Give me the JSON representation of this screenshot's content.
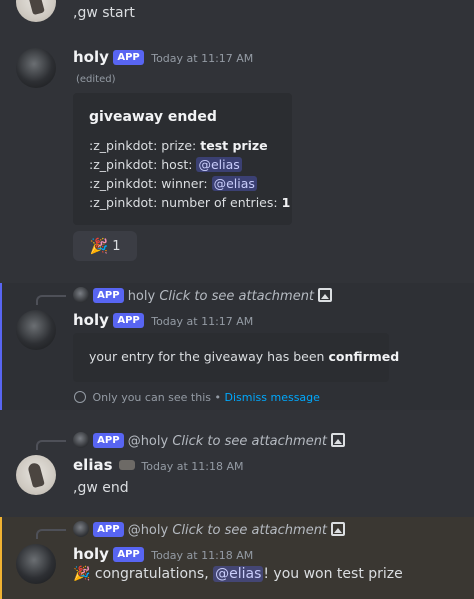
{
  "msg0": {
    "text": ",gw start"
  },
  "msg1": {
    "author": "holy",
    "badge": "APP",
    "time": "Today at 11:17 AM",
    "edited": "(edited)",
    "embed": {
      "title": "giveaway ended",
      "lines": [
        {
          "prefix": ":z_pinkdot: prize: ",
          "bold": "test prize",
          "mention": ""
        },
        {
          "prefix": ":z_pinkdot: host: ",
          "bold": "",
          "mention": "@elias"
        },
        {
          "prefix": ":z_pinkdot: winner: ",
          "bold": "",
          "mention": "@elias"
        },
        {
          "prefix": ":z_pinkdot: number of entries: ",
          "bold": "1",
          "mention": ""
        }
      ]
    },
    "reaction": {
      "emoji": "🎉",
      "count": "1"
    }
  },
  "msg2": {
    "reply": {
      "badge": "APP",
      "who": "holy",
      "text": "Click to see attachment"
    },
    "author": "holy",
    "badge": "APP",
    "time": "Today at 11:17 AM",
    "embed_text_prefix": "your entry for the giveaway has been ",
    "embed_text_bold": "confirmed",
    "ephemeral_note": "Only you can see this",
    "dismiss": "Dismiss message",
    "accent": "#5865f2"
  },
  "msg3": {
    "reply": {
      "badge": "APP",
      "who": "@holy",
      "text": "Click to see attachment"
    },
    "author": "elias",
    "time": "Today at 11:18 AM",
    "text": ",gw end"
  },
  "msg4": {
    "reply": {
      "badge": "APP",
      "who": "@holy",
      "text": "Click to see attachment"
    },
    "author": "holy",
    "badge": "APP",
    "time": "Today at 11:18 AM",
    "emoji": "🎉",
    "text_before": " congratulations, ",
    "mention": "@elias",
    "text_after": "! you won test prize",
    "accent": "#f0b232"
  }
}
